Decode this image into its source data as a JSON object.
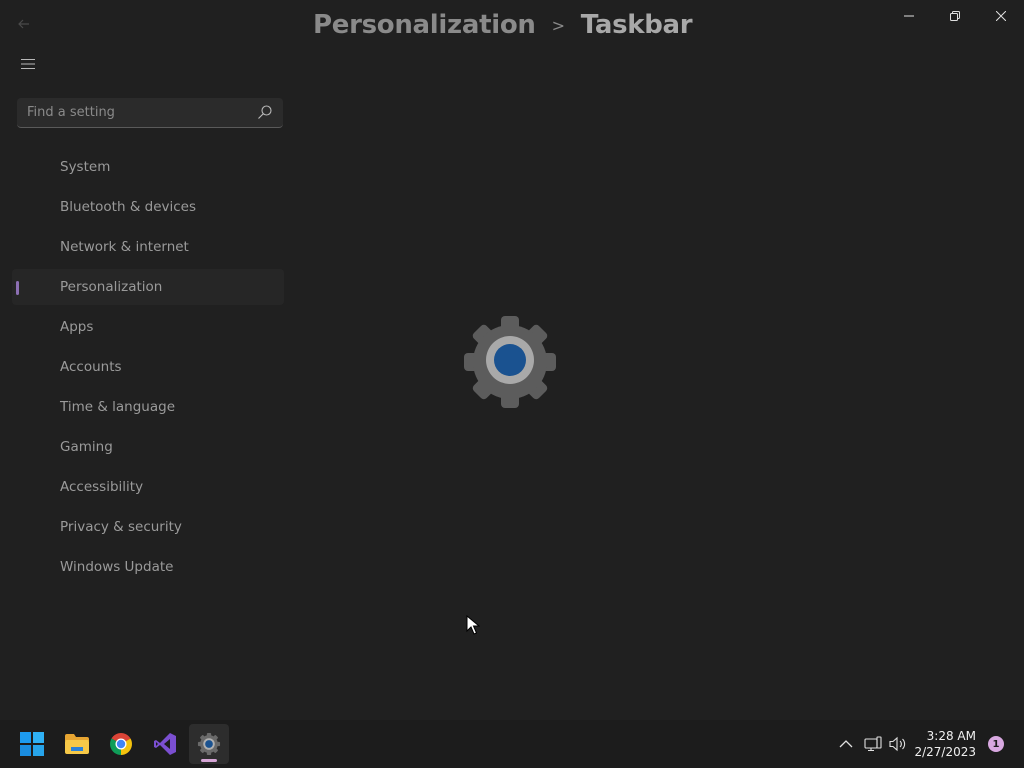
{
  "window": {
    "breadcrumb": {
      "parent": "Personalization",
      "separator": ">",
      "current": "Taskbar"
    }
  },
  "sidebar": {
    "search": {
      "placeholder": "Find a setting"
    },
    "items": [
      {
        "label": "System",
        "selected": false
      },
      {
        "label": "Bluetooth & devices",
        "selected": false
      },
      {
        "label": "Network & internet",
        "selected": false
      },
      {
        "label": "Personalization",
        "selected": true
      },
      {
        "label": "Apps",
        "selected": false
      },
      {
        "label": "Accounts",
        "selected": false
      },
      {
        "label": "Time & language",
        "selected": false
      },
      {
        "label": "Gaming",
        "selected": false
      },
      {
        "label": "Accessibility",
        "selected": false
      },
      {
        "label": "Privacy & security",
        "selected": false
      },
      {
        "label": "Windows Update",
        "selected": false
      }
    ]
  },
  "main": {
    "loading_icon": "settings-gear-icon"
  },
  "taskbar": {
    "apps": [
      {
        "name": "start-icon"
      },
      {
        "name": "file-explorer-icon"
      },
      {
        "name": "chrome-icon"
      },
      {
        "name": "visual-studio-icon"
      },
      {
        "name": "settings-icon",
        "active": true
      }
    ],
    "clock": {
      "time": "3:28 AM",
      "date": "2/27/2023"
    },
    "notification_count": "1"
  },
  "colors": {
    "background": "#202020",
    "accent": "#8c6fb3",
    "taskbar": "#1c1c1c"
  }
}
